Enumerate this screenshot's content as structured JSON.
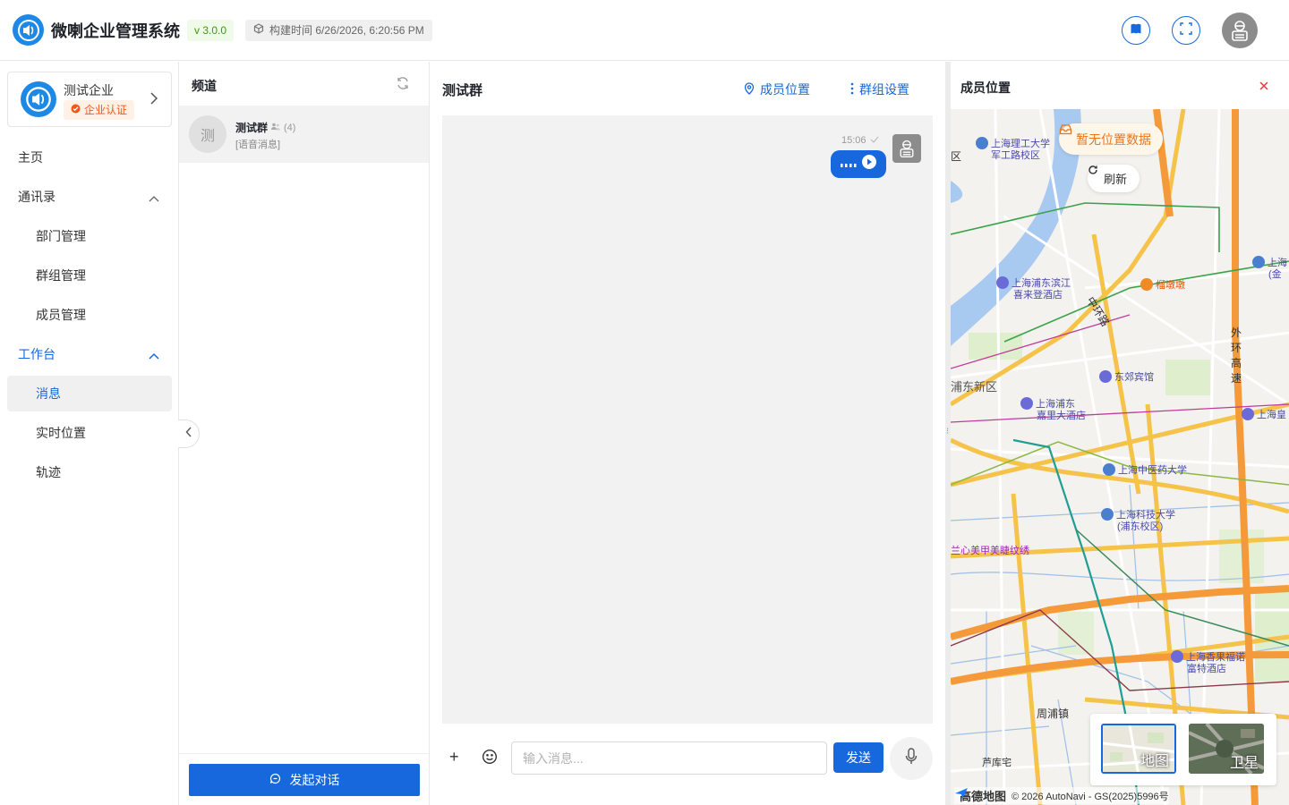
{
  "header": {
    "app_title": "微喇企业管理系统",
    "version": "v 3.0.0",
    "build_time": "构建时间 6/26/2026, 6:20:56 PM"
  },
  "sidebar": {
    "org_name": "测试企业",
    "org_badge": "企业认证",
    "items": [
      {
        "label": "主页"
      },
      {
        "label": "通讯录"
      },
      {
        "label": "部门管理"
      },
      {
        "label": "群组管理"
      },
      {
        "label": "成员管理"
      },
      {
        "label": "工作台"
      },
      {
        "label": "消息"
      },
      {
        "label": "实时位置"
      },
      {
        "label": "轨迹"
      }
    ]
  },
  "channels": {
    "title": "频道",
    "list": [
      {
        "avatar": "测",
        "name": "测试群",
        "count": "(4)",
        "last_message": "[语音消息]"
      }
    ],
    "start_button": "发起对话"
  },
  "chat": {
    "title": "测试群",
    "member_location_link": "成员位置",
    "group_settings_link": "群组设置",
    "message_time": "15:06",
    "input_placeholder": "输入消息...",
    "send_label": "发送",
    "plus": "+"
  },
  "map_panel": {
    "title": "成员位置",
    "no_data": "暂无位置数据",
    "refresh": "刷新",
    "layer_map": "地图",
    "layer_satellite": "卫星",
    "attribution_brand": "高德地图",
    "attribution_text": "© 2026 AutoNavi - GS(2025)5996号",
    "labels": {
      "l1": "上海理工大学",
      "l1b": "军工路校区",
      "l2": "上海浦东滨江",
      "l2b": "喜来登酒店",
      "l3": "榴墩墩",
      "l4": "上海",
      "l4b": "(金",
      "l5": "中环路",
      "l6": "外环高速",
      "l7": "东郊宾馆",
      "l8": "浦东新区",
      "l9": "上海浦东",
      "l9b": "嘉里大酒店",
      "l10": "上海皇",
      "l11": "上海中医药大学",
      "l12": "上海科技大学",
      "l12b": "(浦东校区)",
      "l13": "兰心美甲美睫纹绣",
      "l14": "上海香果福诺",
      "l14b": "富特酒店",
      "l15": "周浦镇",
      "l16": "芦库宅",
      "l17": "区"
    }
  },
  "colors": {
    "primary": "#1668dc",
    "badge_orange": "#fa541c",
    "version_green": "#389e0d"
  }
}
